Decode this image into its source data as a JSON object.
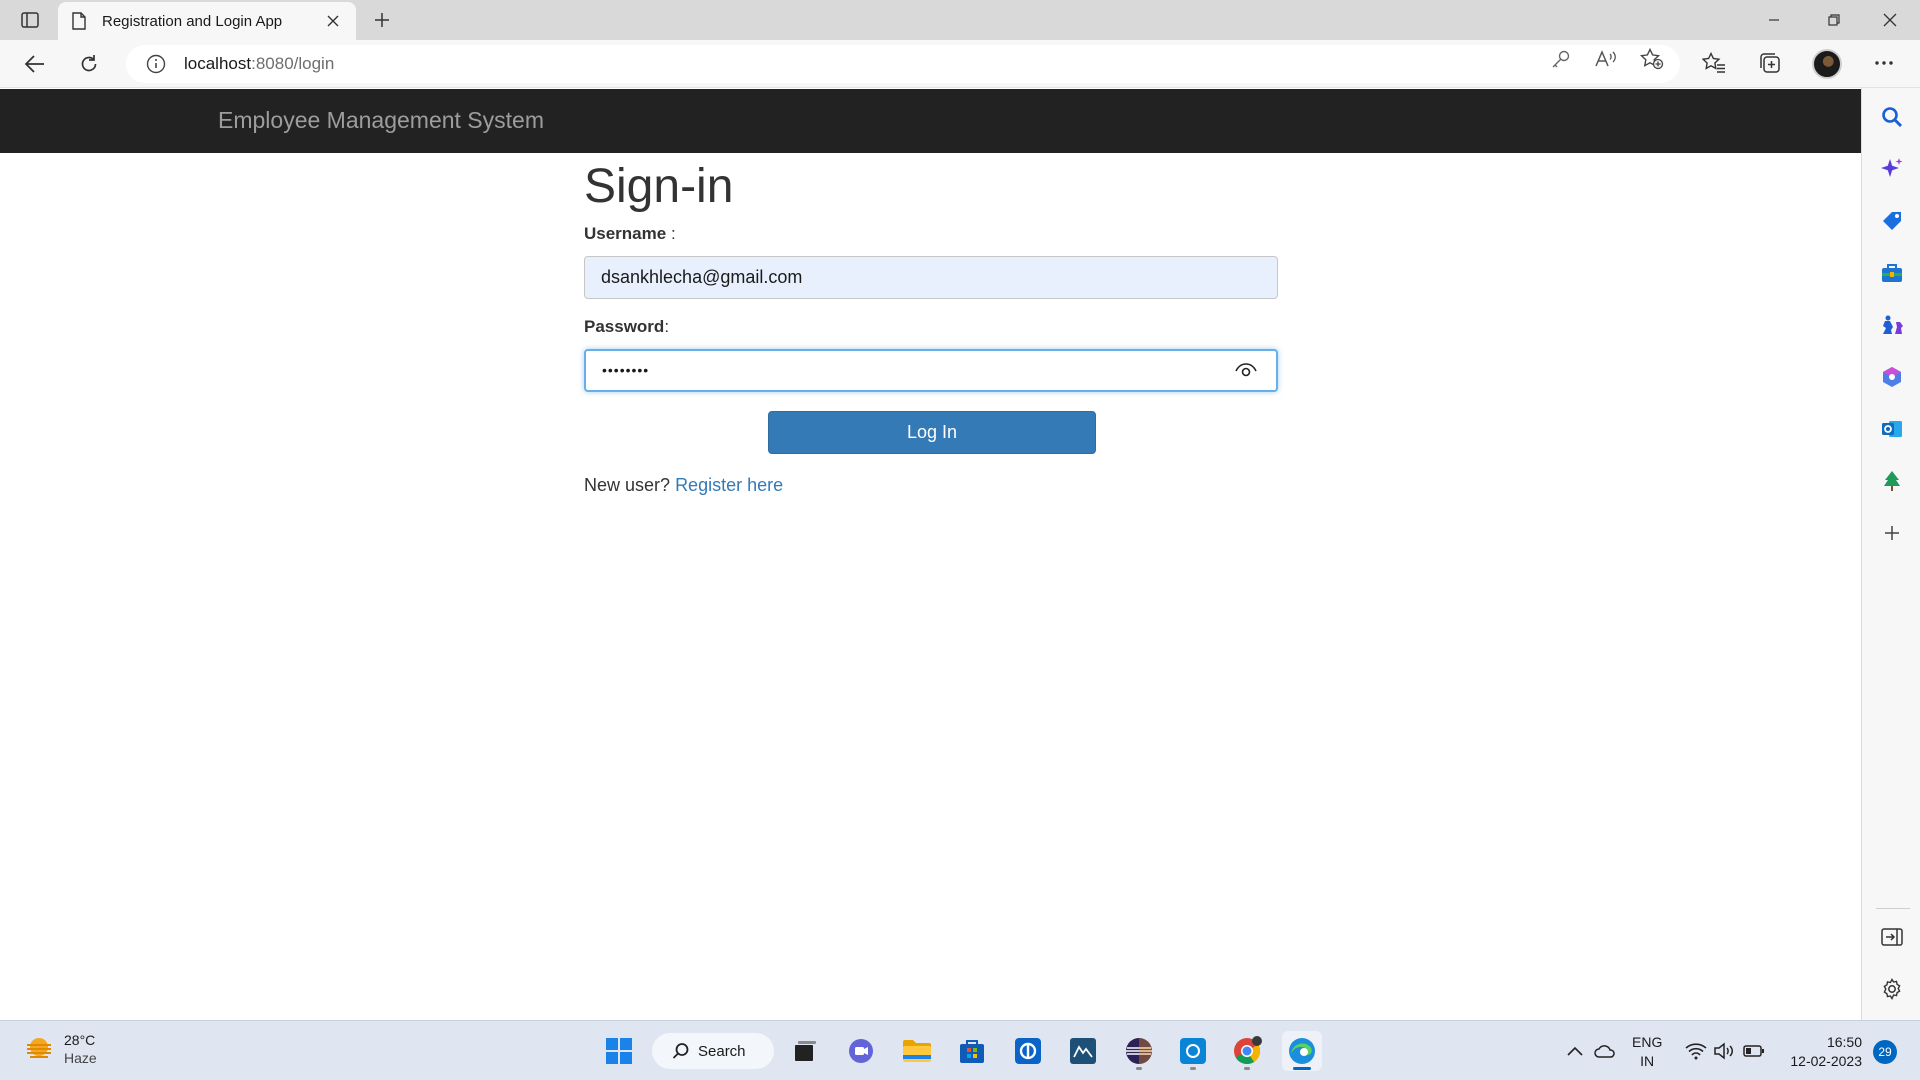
{
  "browser": {
    "tab_title": "Registration and Login App",
    "url_host": "localhost",
    "url_path": ":8080/login"
  },
  "page": {
    "brand": "Employee Management System",
    "form_title": "Sign-in",
    "username_label": "Username",
    "username_suffix": " :",
    "username_value": "dsankhlecha@gmail.com",
    "password_label": "Password",
    "password_suffix": ":",
    "password_masked": "••••••••",
    "login_button": "Log In",
    "new_user_text": "New user?",
    "register_link": "Register here",
    "colors": {
      "navbar_bg": "#222222",
      "brand_text": "#9d9d9d",
      "primary_button": "#337ab7",
      "link": "#337ab7",
      "autofill_bg": "#e8f0fe"
    }
  },
  "sidebar": {
    "icons": [
      "search-icon",
      "copilot-icon",
      "shopping-tag-icon",
      "tools-icon",
      "games-icon",
      "microsoft-365-icon",
      "outlook-icon",
      "drop-tree-icon",
      "add-icon",
      "hide-sidebar-icon",
      "settings-icon"
    ]
  },
  "taskbar": {
    "weather_temp": "28°C",
    "weather_condition": "Haze",
    "search_label": "Search",
    "language_line1": "ENG",
    "language_line2": "IN",
    "time": "16:50",
    "date": "12-02-2023",
    "notification_count": "29"
  }
}
